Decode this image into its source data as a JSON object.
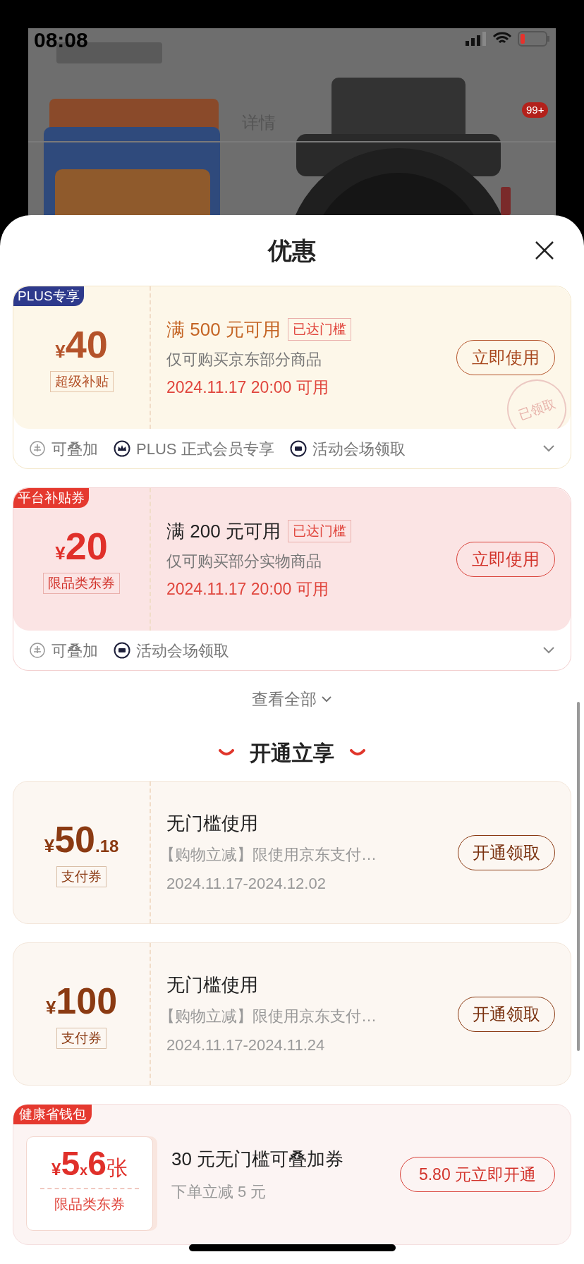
{
  "status_bar": {
    "time": "08:08"
  },
  "background_page": {
    "tab": "详情",
    "cart_badge": "99+"
  },
  "sheet": {
    "title": "优惠"
  },
  "coupons": [
    {
      "kind": "plus",
      "ribbon": "PLUS专享",
      "currency": "¥",
      "amount": "40",
      "tag": "超级补贴",
      "condition": "满 500 元可用",
      "threshold_badge": "已达门槛",
      "scope": "仅可购买京东部分商品",
      "validity": "2024.11.17 20:00 可用",
      "button": "立即使用",
      "stamp": "已领取",
      "expanded": false,
      "features": [
        {
          "kind": "stack",
          "text": "可叠加"
        },
        {
          "kind": "crown",
          "text": "PLUS 正式会员专享"
        },
        {
          "kind": "ticket",
          "text": "活动会场领取"
        }
      ]
    },
    {
      "kind": "platform",
      "ribbon": "平台补贴券",
      "currency": "¥",
      "amount": "20",
      "tag": "限品类东券",
      "condition": "满 200 元可用",
      "threshold_badge": "已达门槛",
      "scope": "仅可购买部分实物商品",
      "validity": "2024.11.17 20:00 可用",
      "button": "立即使用",
      "expanded": false,
      "features": [
        {
          "kind": "stack",
          "text": "可叠加"
        },
        {
          "kind": "ticket",
          "text": "活动会场领取"
        }
      ]
    }
  ],
  "view_all": "查看全部",
  "section_title": "开通立享",
  "offers": [
    {
      "kind": "pay",
      "currency": "¥",
      "amount": "50",
      "decimal": ".18",
      "tag": "支付券",
      "title": "无门槛使用",
      "description": "【购物立减】限使用京东支付…",
      "validity": "2024.11.17-2024.12.02",
      "button": "开通领取"
    },
    {
      "kind": "pay",
      "currency": "¥",
      "amount": "100",
      "tag": "支付券",
      "title": "无门槛使用",
      "description": "【购物立减】限使用京东支付…",
      "validity": "2024.11.17-2024.11.24",
      "button": "开通领取"
    },
    {
      "kind": "wallet",
      "ribbon": "健康省钱包",
      "currency": "¥",
      "amount": "5",
      "times": "x",
      "count": "6",
      "unit": "张",
      "tag": "限品类东券",
      "title": "30 元无门槛可叠加券",
      "description": "下单立减 5 元",
      "button": "5.80 元立即开通"
    }
  ]
}
